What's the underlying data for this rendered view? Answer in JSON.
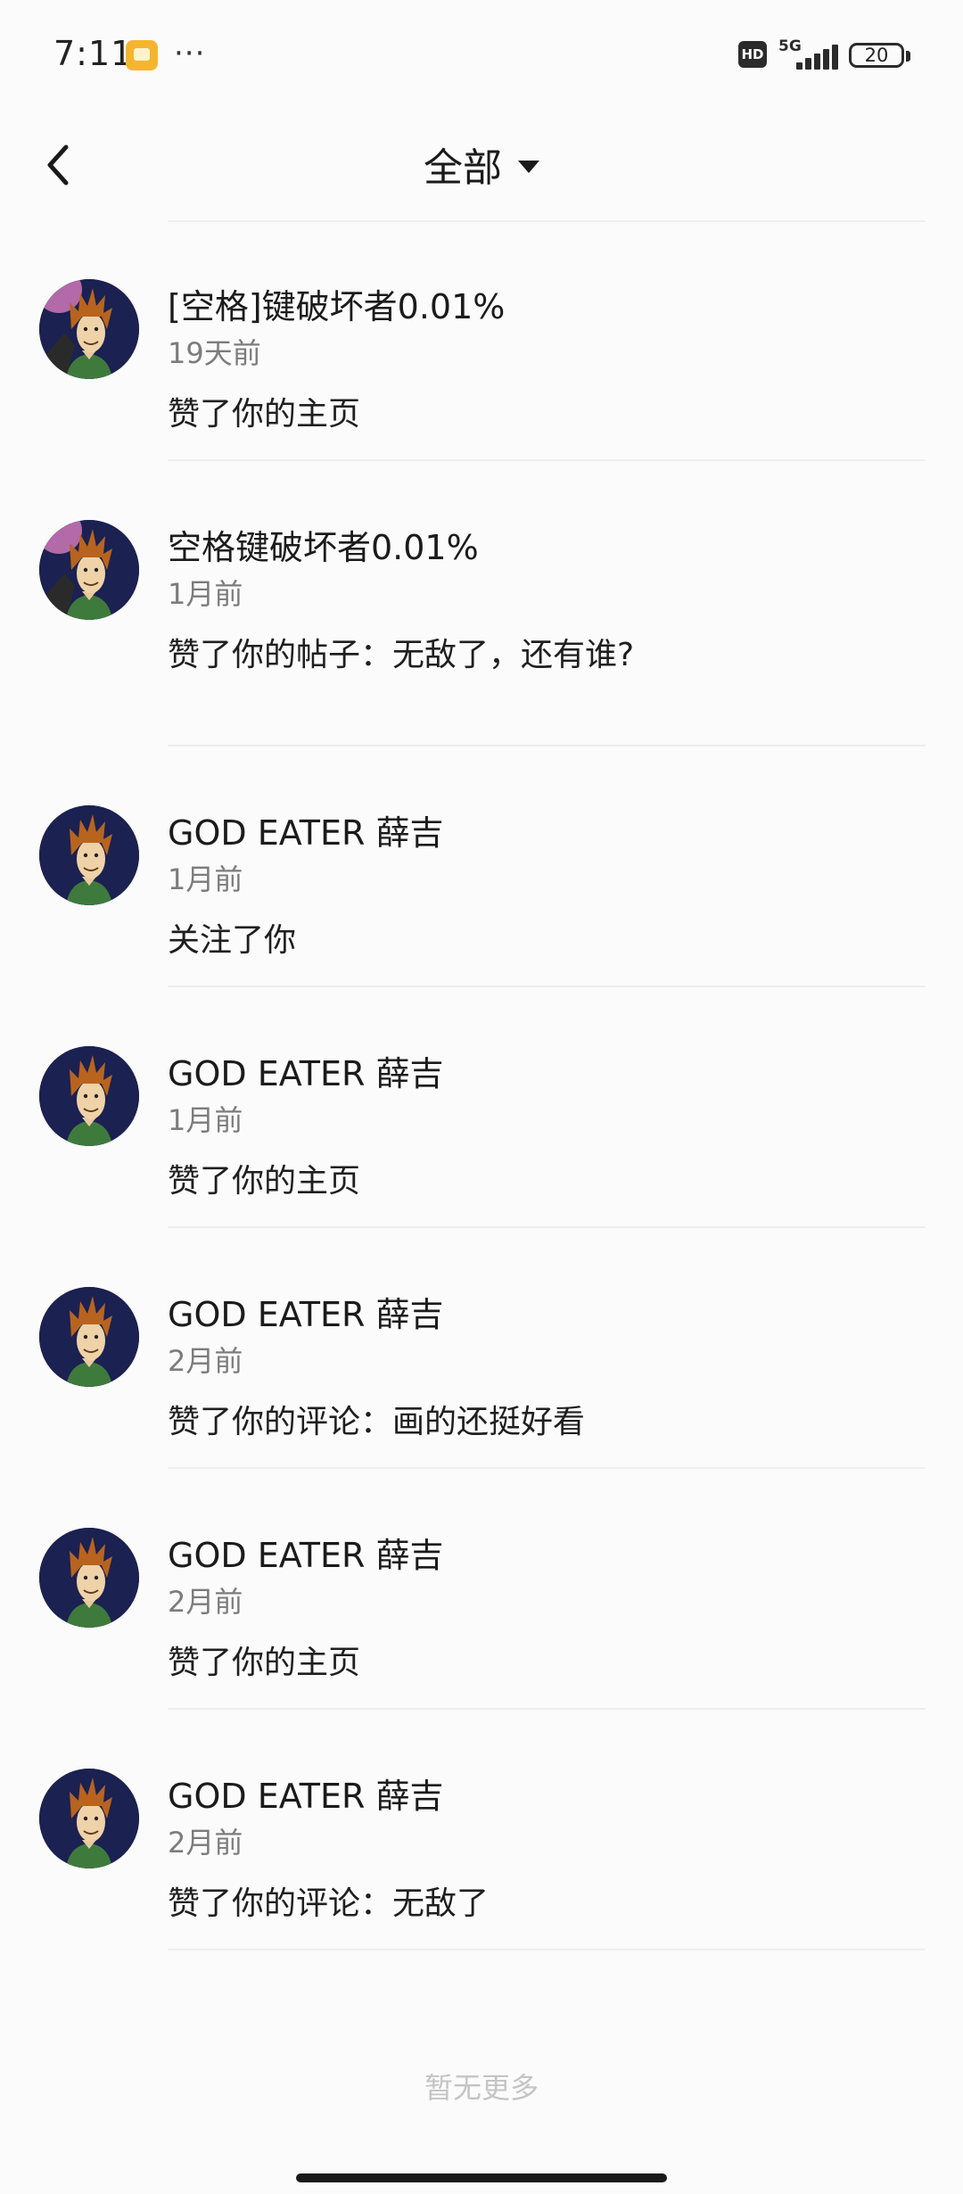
{
  "status_bar": {
    "time": "7:11",
    "more": "···",
    "hd": "HD",
    "network": "5G",
    "battery": "20"
  },
  "header": {
    "title": "全部",
    "back_icon": "chevron-left-icon",
    "dropdown_icon": "caret-down-icon"
  },
  "notifications": [
    {
      "name": "[空格]键破坏者0.01%",
      "time": "19天前",
      "action": "赞了你的主页"
    },
    {
      "name": "空格键破坏者0.01%",
      "time": "1月前",
      "action": "赞了你的帖子：无敌了，还有谁?"
    },
    {
      "name": "GOD EATER 薛吉",
      "time": "1月前",
      "action": "关注了你"
    },
    {
      "name": "GOD EATER 薛吉",
      "time": "1月前",
      "action": "赞了你的主页"
    },
    {
      "name": "GOD EATER 薛吉",
      "time": "2月前",
      "action": "赞了你的评论：画的还挺好看"
    },
    {
      "name": "GOD EATER 薛吉",
      "time": "2月前",
      "action": "赞了你的主页"
    },
    {
      "name": "GOD EATER 薛吉",
      "time": "2月前",
      "action": "赞了你的评论：无敌了"
    }
  ],
  "footer": {
    "no_more": "暂无更多"
  },
  "colors": {
    "background": "#fbfbfc",
    "avatar_bg": "#1b2150",
    "shirt": "#3f7a3d",
    "hair": "#b8641f"
  }
}
